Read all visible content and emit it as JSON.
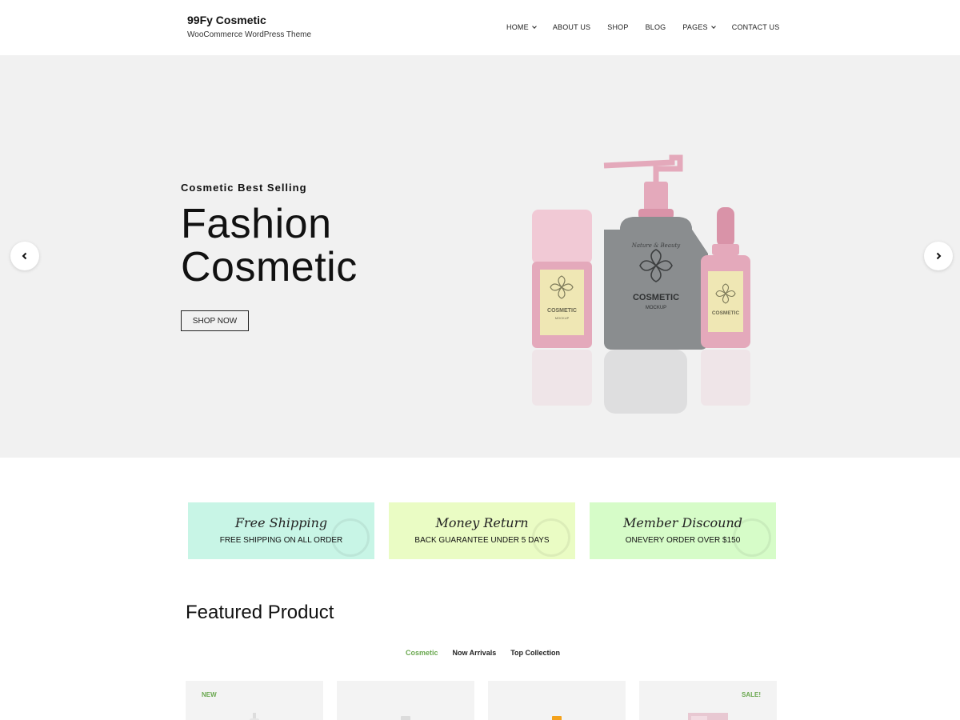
{
  "header": {
    "site_title": "99Fy Cosmetic",
    "tagline": "WooCommerce WordPress Theme",
    "nav": [
      {
        "label": "HOME",
        "has_dropdown": true
      },
      {
        "label": "ABOUT US",
        "has_dropdown": false
      },
      {
        "label": "SHOP",
        "has_dropdown": false
      },
      {
        "label": "BLOG",
        "has_dropdown": false
      },
      {
        "label": "PAGES",
        "has_dropdown": true
      },
      {
        "label": "CONTACT US",
        "has_dropdown": false
      }
    ]
  },
  "hero": {
    "subtitle": "Cosmetic Best Selling",
    "title_line1": "Fashion",
    "title_line2": "Cosmetic",
    "button_label": "SHOP NOW",
    "prev_icon": "chevron-left-icon",
    "next_icon": "chevron-right-icon",
    "product_labels": {
      "script": "Nature & Beauty",
      "brand": "COSMETIC",
      "sub": "MOCKUP"
    }
  },
  "features": [
    {
      "title": "Free Shipping",
      "desc": "FREE SHIPPING ON ALL ORDER",
      "color": "#c8f5e6"
    },
    {
      "title": "Money Return",
      "desc": "BACK GUARANTEE UNDER 5 DAYS",
      "color": "#eafcc4"
    },
    {
      "title": "Member Discound",
      "desc": "ONEVERY ORDER OVER $150",
      "color": "#d6fcc8"
    }
  ],
  "featured": {
    "title": "Featured Product",
    "tabs": [
      {
        "label": "Cosmetic",
        "active": true
      },
      {
        "label": "Now Arrivals",
        "active": false
      },
      {
        "label": "Top Collection",
        "active": false
      }
    ],
    "products": [
      {
        "badge": "NEW",
        "badge_side": "left"
      },
      {
        "badge": "",
        "badge_side": ""
      },
      {
        "badge": "",
        "badge_side": ""
      },
      {
        "badge": "SALE!",
        "badge_side": "right"
      }
    ]
  },
  "colors": {
    "accent": "#6aa84f",
    "hero_bg": "#f1f1f1",
    "bottle_pink": "#e8b4c4",
    "bottle_gray": "#8a8d8f",
    "label_cream": "#efe7b4"
  }
}
